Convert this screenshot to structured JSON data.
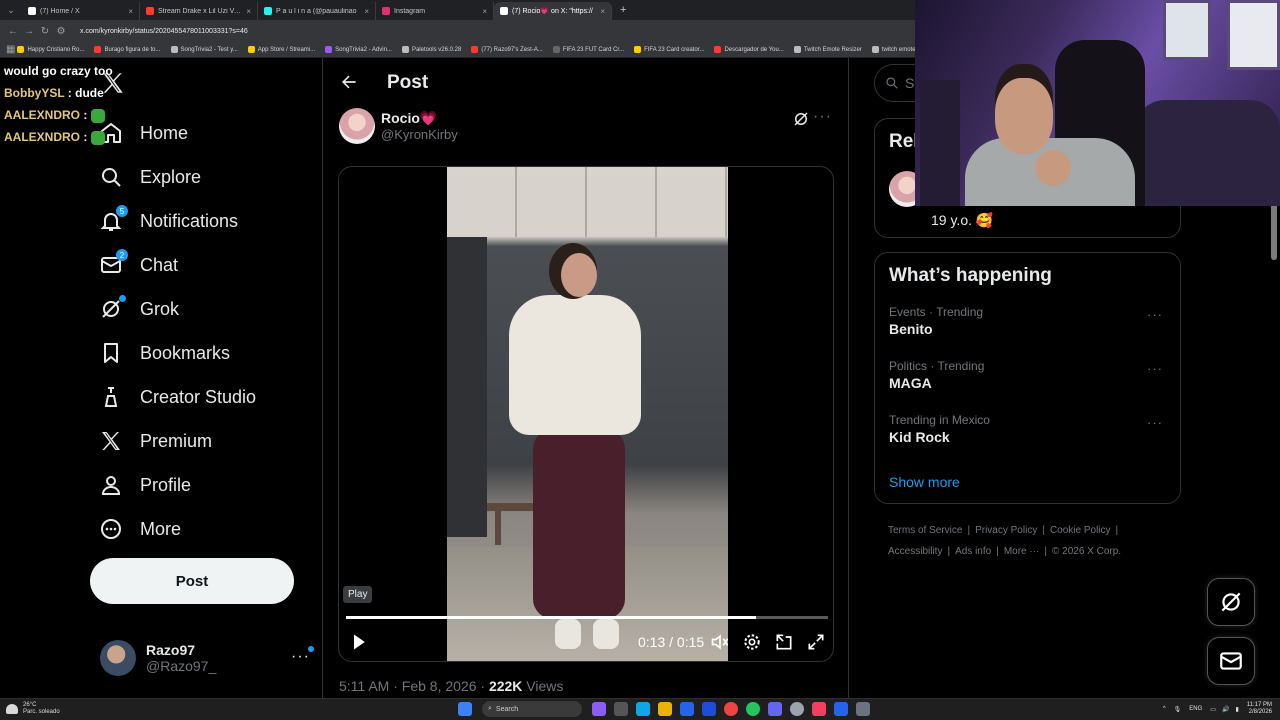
{
  "browser": {
    "tabs": [
      {
        "title": "(7) Home / X",
        "color": "#ffffff",
        "active": false
      },
      {
        "title": "Stream Drake x Lil Uzi Vert - Al",
        "color": "#ff3b30",
        "active": false
      },
      {
        "title": "P a u l i n a (@pauaulinao",
        "color": "#25f4ee",
        "active": false
      },
      {
        "title": "Instagram",
        "color": "#e1306c",
        "active": false
      },
      {
        "title": "(7) Rocio💗 on X: \"https://",
        "color": "#ffffff",
        "active": true
      }
    ],
    "url": "x.com/kyronkirby/status/2020455478011003331?s=46",
    "bookmarks": [
      {
        "label": "Happy Cristiano Ro...",
        "color": "#ffcc00"
      },
      {
        "label": "Burago figura de to...",
        "color": "#ff3b30"
      },
      {
        "label": "SongTrivia2 - Test y...",
        "color": "#bbbbbb"
      },
      {
        "label": "App Store / Streami...",
        "color": "#ffcc00"
      },
      {
        "label": "SongTrivia2 - Advin...",
        "color": "#9b59ff"
      },
      {
        "label": "Paletools v26.0.28",
        "color": "#bbbbbb"
      },
      {
        "label": "(77) Razo97's Zest-A...",
        "color": "#ff3b30"
      },
      {
        "label": "FIFA 23 FUT Card Cr...",
        "color": "#666666"
      },
      {
        "label": "FIFA 23 Card creator...",
        "color": "#ffcc00"
      },
      {
        "label": "Descargador de You...",
        "color": "#ff3b30"
      },
      {
        "label": "Twitch Emote Resizer",
        "color": "#bbbbbb"
      },
      {
        "label": "twitch emote ro...",
        "color": "#bbbbbb"
      }
    ]
  },
  "chat": [
    {
      "user": "",
      "message": "would go crazy too",
      "emote": false
    },
    {
      "user": "BobbyYSL",
      "message": " : dude",
      "emote": false
    },
    {
      "user": "AALEXNDRO",
      "message": " :",
      "emote": true
    },
    {
      "user": "AALEXNDRO",
      "message": " :",
      "emote": true
    }
  ],
  "nav": {
    "items": [
      {
        "label": "Home",
        "icon": "home-icon"
      },
      {
        "label": "Explore",
        "icon": "search-icon"
      },
      {
        "label": "Notifications",
        "icon": "bell-icon",
        "badge": "5"
      },
      {
        "label": "Chat",
        "icon": "mail-icon",
        "badge": "2"
      },
      {
        "label": "Grok",
        "icon": "grok-icon"
      },
      {
        "label": "Bookmarks",
        "icon": "bookmark-icon"
      },
      {
        "label": "Creator Studio",
        "icon": "creator-icon"
      },
      {
        "label": "Premium",
        "icon": "x-icon"
      },
      {
        "label": "Profile",
        "icon": "person-icon"
      },
      {
        "label": "More",
        "icon": "more-circle-icon"
      }
    ],
    "post_button": "Post",
    "account": {
      "name": "Razo97",
      "handle": "@Razo97_",
      "more": "···"
    }
  },
  "main": {
    "title": "Post",
    "author": {
      "name": "Rocio",
      "heart": "💗",
      "handle": "@KyronKirby"
    },
    "video": {
      "tooltip": "Play",
      "time": "0:13 / 0:15",
      "progress": 0.85
    },
    "meta": {
      "time": "5:11 AM · Feb 8, 2026 · ",
      "views": "222K",
      "views_label": " Views"
    }
  },
  "right": {
    "search_placeholder": "S",
    "relevant_title": "Rel",
    "relevant_bio": "19 y.o. 🥰",
    "happening_title": "What’s happening",
    "trends": [
      {
        "category": "Events · Trending",
        "name": "Benito"
      },
      {
        "category": "Politics · Trending",
        "name": "MAGA"
      },
      {
        "category": "Trending in Mexico",
        "name": "Kid Rock"
      }
    ],
    "show_more": "Show more",
    "footer": [
      "Terms of Service",
      "Privacy Policy",
      "Cookie Policy",
      "Accessibility",
      "Ads info",
      "More ···",
      "© 2026 X Corp."
    ]
  },
  "taskbar": {
    "weather_temp": "26°C",
    "weather_desc": "Parc. soleado",
    "search": "Search",
    "lang": "ENG",
    "time": "11:17 PM",
    "date": "2/8/2026"
  },
  "colors": {
    "accent": "#1d9bf0",
    "background": "#000000",
    "text": "#e7e9ea",
    "muted": "#71767b"
  }
}
